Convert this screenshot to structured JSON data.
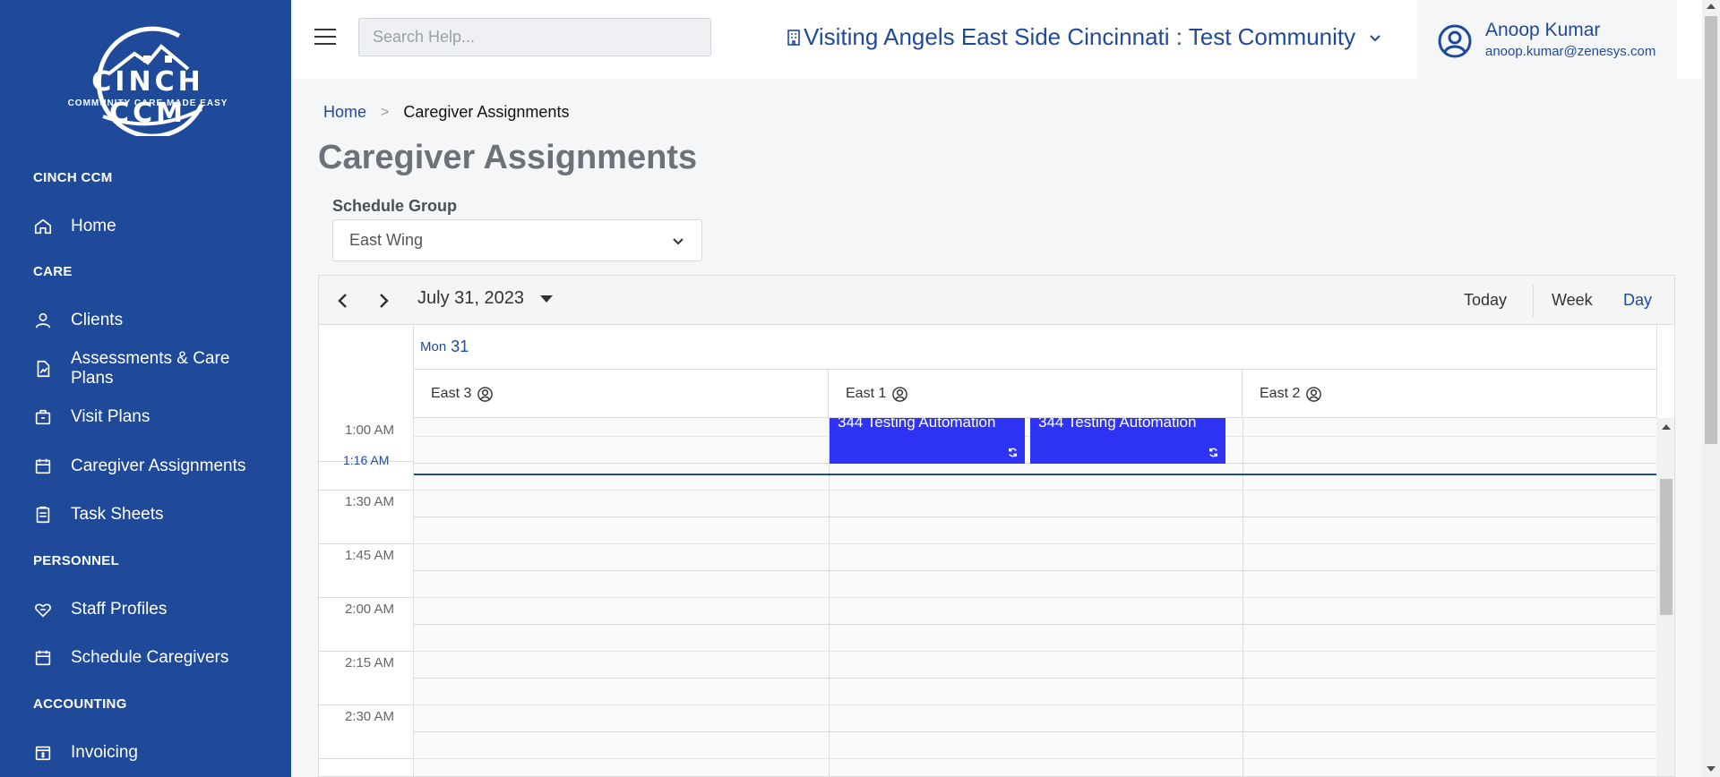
{
  "colors": {
    "sidebar": "#1f4a9a",
    "accent": "#1f4a9a",
    "event": "#2e33f5"
  },
  "logo": {
    "title": "CINCH CCM",
    "tagline": "COMMUNITY CARE MADE EASY"
  },
  "sidebar": {
    "sections": [
      {
        "label": "CINCH CCM"
      },
      {
        "label": "CARE"
      },
      {
        "label": "PERSONNEL"
      },
      {
        "label": "ACCOUNTING"
      }
    ],
    "items": [
      {
        "label": "Home",
        "icon": "home-icon"
      },
      {
        "label": "Clients",
        "icon": "user-icon"
      },
      {
        "label": "Assessments & Care Plans",
        "icon": "file-chart-icon"
      },
      {
        "label": "Visit Plans",
        "icon": "briefcase-icon"
      },
      {
        "label": "Caregiver Assignments",
        "icon": "calendar-icon"
      },
      {
        "label": "Task Sheets",
        "icon": "clipboard-icon"
      },
      {
        "label": "Staff Profiles",
        "icon": "heart-hand-icon"
      },
      {
        "label": "Schedule Caregivers",
        "icon": "calendar-icon"
      },
      {
        "label": "Invoicing",
        "icon": "invoice-icon"
      }
    ]
  },
  "header": {
    "search_placeholder": "Search Help...",
    "community": "Visiting Angels East Side Cincinnati : Test Community",
    "user_name": "Anoop Kumar",
    "user_email": "anoop.kumar@zenesys.com"
  },
  "breadcrumb": {
    "home": "Home",
    "separator": ">",
    "current": "Caregiver Assignments"
  },
  "page_title": "Caregiver Assignments",
  "schedule_group": {
    "label": "Schedule Group",
    "value": "East Wing"
  },
  "scheduler": {
    "date": "July 31, 2023",
    "views": {
      "today": "Today",
      "week": "Week",
      "day": "Day",
      "active": "Day"
    },
    "day_header": {
      "dow": "Mon",
      "day": "31"
    },
    "resources": [
      "East 3",
      "East 1",
      "East 2"
    ],
    "time_labels": [
      "1:00 AM",
      "1:30 AM",
      "1:45 AM",
      "2:00 AM",
      "2:15 AM",
      "2:30 AM"
    ],
    "now_label": "1:16 AM",
    "events": [
      {
        "title": "344 Testing Automation",
        "resource": "East 1",
        "recurring": true
      },
      {
        "title": "344 Testing Automation",
        "resource": "East 1",
        "recurring": true
      }
    ]
  }
}
